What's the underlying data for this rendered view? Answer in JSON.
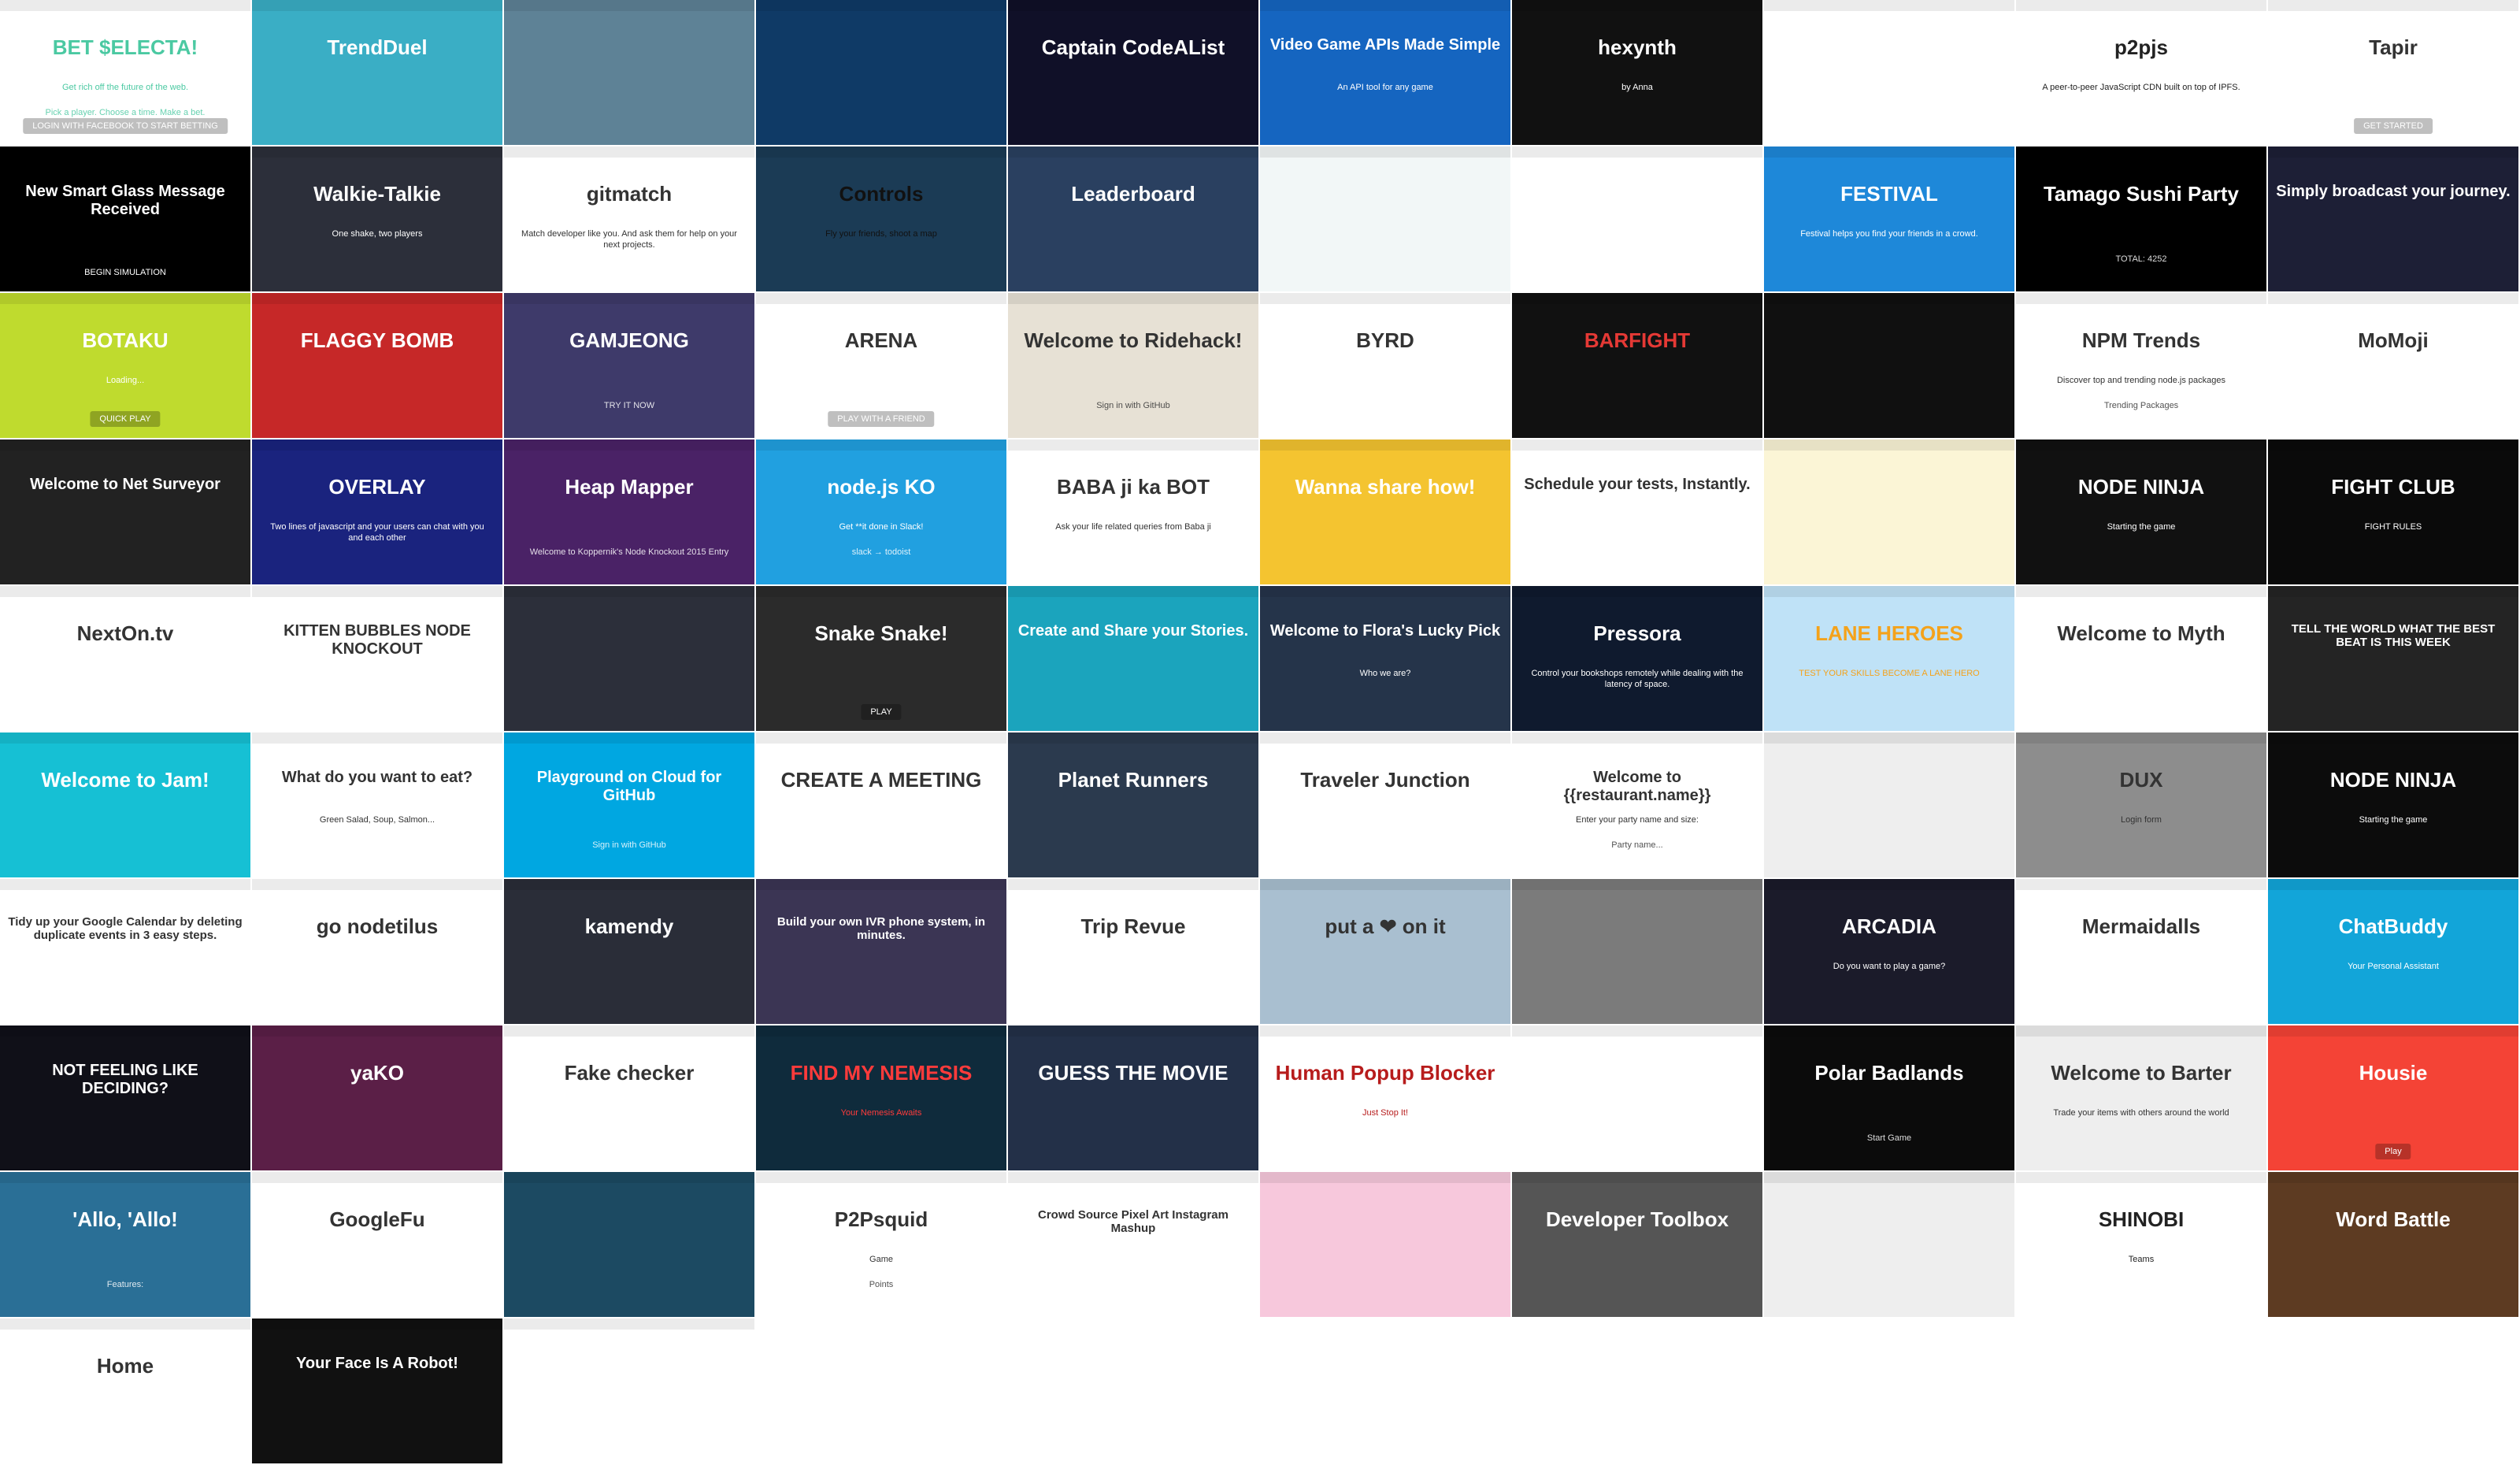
{
  "tiles": [
    {
      "title": "BET $ELECTA!",
      "subtitle": "Get rich off the future of the web.",
      "body": "Pick a player. Choose a time. Make a bet.",
      "button": "LOGIN WITH FACEBOOK TO START BETTING",
      "bg": "#ffffff",
      "fg": "#4bc9a2"
    },
    {
      "title": "TrendDuel",
      "subtitle": "",
      "body": "",
      "button": "",
      "bg": "#3aaec5",
      "fg": "#ffffff"
    },
    {
      "title": "",
      "subtitle": "",
      "body": "",
      "button": "",
      "bg": "#5e8296",
      "fg": "#ffffff"
    },
    {
      "title": "",
      "subtitle": "",
      "body": "",
      "button": "",
      "bg": "#0f3a66",
      "fg": "#ffffff"
    },
    {
      "title": "Captain CodeAList",
      "subtitle": "",
      "body": "",
      "button": "",
      "bg": "#101028",
      "fg": "#ffffff"
    },
    {
      "title": "Video Game APIs Made Simple",
      "subtitle": "An API tool for any game",
      "body": "",
      "button": "",
      "bg": "#1565c0",
      "fg": "#ffffff"
    },
    {
      "title": "hexynth",
      "subtitle": "by Anna",
      "body": "",
      "button": "",
      "bg": "#111111",
      "fg": "#ffffff"
    },
    {
      "title": "",
      "subtitle": "",
      "body": "",
      "button": "",
      "bg": "#ffffff",
      "fg": "#333333"
    },
    {
      "title": "p2pjs",
      "subtitle": "A peer-to-peer JavaScript CDN built on top of IPFS.",
      "body": "",
      "button": "",
      "bg": "#ffffff",
      "fg": "#222222"
    },
    {
      "title": "Tapir",
      "subtitle": "",
      "body": "",
      "button": "GET STARTED",
      "bg": "#ffffff",
      "fg": "#333333"
    },
    {
      "title": "New Smart Glass Message Received",
      "subtitle": "",
      "body": "",
      "button": "BEGIN SIMULATION",
      "bg": "#000000",
      "fg": "#ffffff"
    },
    {
      "title": "Walkie-Talkie",
      "subtitle": "One shake, two players",
      "body": "",
      "button": "",
      "bg": "#2c2f3a",
      "fg": "#ffffff"
    },
    {
      "title": "gitmatch",
      "subtitle": "Match developer like you. And ask them for help on your next projects.",
      "body": "",
      "button": "",
      "bg": "#ffffff",
      "fg": "#333333"
    },
    {
      "title": "Controls",
      "subtitle": "Fly your friends, shoot a map",
      "body": "",
      "button": "",
      "bg": "#1b3b55",
      "fg": "#111111"
    },
    {
      "title": "Leaderboard",
      "subtitle": "",
      "body": "",
      "button": "",
      "bg": "#2a4060",
      "fg": "#ffffff"
    },
    {
      "title": "",
      "subtitle": "",
      "body": "",
      "button": "",
      "bg": "#f2f7f7",
      "fg": "#333333"
    },
    {
      "title": "",
      "subtitle": "",
      "body": "",
      "button": "",
      "bg": "#ffffff",
      "fg": "#333333"
    },
    {
      "title": "FESTIVAL",
      "subtitle": "Festival helps you find your friends in a crowd.",
      "body": "",
      "button": "",
      "bg": "#1e88d9",
      "fg": "#ffffff"
    },
    {
      "title": "Tamago Sushi Party",
      "subtitle": "",
      "body": "TOTAL: 4252",
      "button": "",
      "bg": "#000000",
      "fg": "#ffffff"
    },
    {
      "title": "Simply broadcast your journey.",
      "subtitle": "",
      "body": "",
      "button": "",
      "bg": "#1d1f36",
      "fg": "#ffffff"
    },
    {
      "title": "BOTAKU",
      "subtitle": "Loading...",
      "body": "",
      "button": "QUICK PLAY",
      "bg": "#bfdb2e",
      "fg": "#ffffff"
    },
    {
      "title": "FLAGGY BOMB",
      "subtitle": "",
      "body": "",
      "button": "",
      "bg": "#c62828",
      "fg": "#ffffff"
    },
    {
      "title": "GAMJEONG",
      "subtitle": "",
      "body": "TRY IT NOW",
      "button": "",
      "bg": "#3e3a6a",
      "fg": "#ffffff"
    },
    {
      "title": "ARENA",
      "subtitle": "",
      "body": "",
      "button": "PLAY WITH A FRIEND",
      "bg": "#ffffff",
      "fg": "#333333"
    },
    {
      "title": "Welcome to Ridehack!",
      "subtitle": "",
      "body": "Sign in with GitHub",
      "button": "",
      "bg": "#e7e1d5",
      "fg": "#333333"
    },
    {
      "title": "BYRD",
      "subtitle": "",
      "body": "",
      "button": "",
      "bg": "#ffffff",
      "fg": "#333333"
    },
    {
      "title": "BARFIGHT",
      "subtitle": "",
      "body": "",
      "button": "",
      "bg": "#111111",
      "fg": "#e53935"
    },
    {
      "title": "",
      "subtitle": "",
      "body": "",
      "button": "",
      "bg": "#101010",
      "fg": "#ffffff"
    },
    {
      "title": "NPM Trends",
      "subtitle": "Discover top and trending node.js packages",
      "body": "Trending Packages",
      "button": "",
      "bg": "#ffffff",
      "fg": "#333333"
    },
    {
      "title": "MoMoji",
      "subtitle": "",
      "body": "",
      "button": "",
      "bg": "#ffffff",
      "fg": "#333333"
    },
    {
      "title": "Welcome to Net Surveyor",
      "subtitle": "",
      "body": "",
      "button": "",
      "bg": "#222222",
      "fg": "#ffffff"
    },
    {
      "title": "OVERLAY",
      "subtitle": "Two lines of javascript and your users can chat with you and each other",
      "body": "",
      "button": "",
      "bg": "#1a237e",
      "fg": "#ffffff"
    },
    {
      "title": "Heap Mapper",
      "subtitle": "",
      "body": "Welcome to Koppernik's Node Knockout 2015 Entry",
      "button": "",
      "bg": "#4a2266",
      "fg": "#ffffff"
    },
    {
      "title": "node.js KO",
      "subtitle": "Get **it done in Slack!",
      "body": "slack → todoist",
      "button": "",
      "bg": "#21a0e0",
      "fg": "#ffffff"
    },
    {
      "title": "BABA ji ka BOT",
      "subtitle": "Ask your life related queries from Baba ji",
      "body": "",
      "button": "",
      "bg": "#ffffff",
      "fg": "#333333"
    },
    {
      "title": "Wanna share how!",
      "subtitle": "",
      "body": "",
      "button": "",
      "bg": "#f4c430",
      "fg": "#ffffff"
    },
    {
      "title": "Schedule your tests, Instantly.",
      "subtitle": "",
      "body": "",
      "button": "",
      "bg": "#ffffff",
      "fg": "#333333"
    },
    {
      "title": "",
      "subtitle": "",
      "body": "",
      "button": "",
      "bg": "#fbf5d6",
      "fg": "#333333"
    },
    {
      "title": "NODE NINJA",
      "subtitle": "Starting the game",
      "body": "",
      "button": "",
      "bg": "#111111",
      "fg": "#ffffff"
    },
    {
      "title": "FIGHT CLUB",
      "subtitle": "FIGHT RULES",
      "body": "",
      "button": "",
      "bg": "#0a0a0a",
      "fg": "#ffffff"
    },
    {
      "title": "NextOn.tv",
      "subtitle": "",
      "body": "",
      "button": "",
      "bg": "#ffffff",
      "fg": "#333333"
    },
    {
      "title": "KITTEN BUBBLES NODE KNOCKOUT",
      "subtitle": "",
      "body": "",
      "button": "",
      "bg": "#ffffff",
      "fg": "#333333"
    },
    {
      "title": "",
      "subtitle": "",
      "body": "",
      "button": "",
      "bg": "#2c2f3a",
      "fg": "#ffffff"
    },
    {
      "title": "Snake Snake!",
      "subtitle": "",
      "body": "",
      "button": "PLAY",
      "bg": "#2b2b2b",
      "fg": "#ffffff"
    },
    {
      "title": "Create and Share your Stories.",
      "subtitle": "",
      "body": "",
      "button": "",
      "bg": "#1ba4bd",
      "fg": "#ffffff"
    },
    {
      "title": "Welcome to Flora's Lucky Pick",
      "subtitle": "Who we are?",
      "body": "",
      "button": "",
      "bg": "#25344a",
      "fg": "#ffffff"
    },
    {
      "title": "Pressora",
      "subtitle": "Control your bookshops remotely while dealing with the latency of space.",
      "body": "",
      "button": "",
      "bg": "#0f1a2e",
      "fg": "#ffffff"
    },
    {
      "title": "LANE HEROES",
      "subtitle": "TEST YOUR SKILLS BECOME A LANE HERO",
      "body": "",
      "button": "",
      "bg": "#bfe2f7",
      "fg": "#f4a21b"
    },
    {
      "title": "Welcome to Myth",
      "subtitle": "",
      "body": "",
      "button": "",
      "bg": "#ffffff",
      "fg": "#333333"
    },
    {
      "title": "TELL THE WORLD WHAT THE BEST BEAT IS THIS WEEK",
      "subtitle": "",
      "body": "",
      "button": "",
      "bg": "#242424",
      "fg": "#ffffff"
    },
    {
      "title": "Welcome to Jam!",
      "subtitle": "",
      "body": "",
      "button": "",
      "bg": "#16c0d4",
      "fg": "#ffffff"
    },
    {
      "title": "What do you want to eat?",
      "subtitle": "Green Salad, Soup, Salmon...",
      "body": "",
      "button": "",
      "bg": "#ffffff",
      "fg": "#333333"
    },
    {
      "title": "Playground on Cloud for GitHub",
      "subtitle": "",
      "body": "Sign in with GitHub",
      "button": "",
      "bg": "#00a7e1",
      "fg": "#ffffff"
    },
    {
      "title": "CREATE A MEETING",
      "subtitle": "",
      "body": "",
      "button": "",
      "bg": "#ffffff",
      "fg": "#333333"
    },
    {
      "title": "Planet Runners",
      "subtitle": "",
      "body": "",
      "button": "",
      "bg": "#2b3a4e",
      "fg": "#ffffff"
    },
    {
      "title": "Traveler Junction",
      "subtitle": "",
      "body": "",
      "button": "",
      "bg": "#ffffff",
      "fg": "#333333"
    },
    {
      "title": "Welcome to {{restaurant.name}}",
      "subtitle": "Enter your party name and size:",
      "body": "Party name...",
      "button": "",
      "bg": "#ffffff",
      "fg": "#333333"
    },
    {
      "title": "",
      "subtitle": "",
      "body": "",
      "button": "",
      "bg": "#eeeeee",
      "fg": "#333333"
    },
    {
      "title": "DUX",
      "subtitle": "Login form",
      "body": "",
      "button": "",
      "bg": "#8d8d8d",
      "fg": "#333333"
    },
    {
      "title": "NODE NINJA",
      "subtitle": "Starting the game",
      "body": "",
      "button": "",
      "bg": "#0c0c0c",
      "fg": "#ffffff"
    },
    {
      "title": "Tidy up your Google Calendar by deleting duplicate events in 3 easy steps.",
      "subtitle": "",
      "body": "",
      "button": "",
      "bg": "#ffffff",
      "fg": "#333333"
    },
    {
      "title": "go nodetilus",
      "subtitle": "",
      "body": "",
      "button": "",
      "bg": "#ffffff",
      "fg": "#333333"
    },
    {
      "title": "kamendy",
      "subtitle": "",
      "body": "",
      "button": "",
      "bg": "#2a2d38",
      "fg": "#ffffff"
    },
    {
      "title": "Build your own IVR phone system, in minutes.",
      "subtitle": "",
      "body": "",
      "button": "",
      "bg": "#3b3554",
      "fg": "#ffffff"
    },
    {
      "title": "Trip Revue",
      "subtitle": "",
      "body": "",
      "button": "",
      "bg": "#ffffff",
      "fg": "#333333"
    },
    {
      "title": "put a ❤ on it",
      "subtitle": "",
      "body": "",
      "button": "",
      "bg": "#a9bfd0",
      "fg": "#333333"
    },
    {
      "title": "",
      "subtitle": "",
      "body": "",
      "button": "",
      "bg": "#7b7b7b",
      "fg": "#ffffff"
    },
    {
      "title": "ARCADIA",
      "subtitle": "Do you want to play a game?",
      "body": "",
      "button": "",
      "bg": "#1b1b2a",
      "fg": "#ffffff"
    },
    {
      "title": "Mermaidalls",
      "subtitle": "",
      "body": "",
      "button": "",
      "bg": "#ffffff",
      "fg": "#333333"
    },
    {
      "title": "ChatBuddy",
      "subtitle": "Your Personal Assistant",
      "body": "",
      "button": "",
      "bg": "#12a5d9",
      "fg": "#ffffff"
    },
    {
      "title": "NOT FEELING LIKE DECIDING?",
      "subtitle": "",
      "body": "",
      "button": "",
      "bg": "#101018",
      "fg": "#ffffff"
    },
    {
      "title": "yaKO",
      "subtitle": "",
      "body": "",
      "button": "",
      "bg": "#5b1f47",
      "fg": "#ffffff"
    },
    {
      "title": "Fake checker",
      "subtitle": "",
      "body": "",
      "button": "",
      "bg": "#ffffff",
      "fg": "#333333"
    },
    {
      "title": "FIND MY NEMESIS",
      "subtitle": "Your Nemesis Awaits",
      "body": "",
      "button": "",
      "bg": "#0f2b3c",
      "fg": "#ff3b3b"
    },
    {
      "title": "GUESS THE MOVIE",
      "subtitle": "",
      "body": "",
      "button": "",
      "bg": "#233048",
      "fg": "#ffffff"
    },
    {
      "title": "Human Popup Blocker",
      "subtitle": "Just Stop It!",
      "body": "",
      "button": "",
      "bg": "#ffffff",
      "fg": "#b71c1c"
    },
    {
      "title": "",
      "subtitle": "",
      "body": "",
      "button": "",
      "bg": "#ffffff",
      "fg": "#333333"
    },
    {
      "title": "Polar Badlands",
      "subtitle": "",
      "body": "Start Game",
      "button": "",
      "bg": "#0b0b0b",
      "fg": "#ffffff"
    },
    {
      "title": "Welcome to Barter",
      "subtitle": "Trade your items with others around the world",
      "body": "",
      "button": "",
      "bg": "#eeeeee",
      "fg": "#333333"
    },
    {
      "title": "Housie",
      "subtitle": "",
      "body": "",
      "button": "Play",
      "bg": "#f44336",
      "fg": "#ffffff"
    },
    {
      "title": "'Allo, 'Allo!",
      "subtitle": "",
      "body": "Features:",
      "button": "",
      "bg": "#2a6f96",
      "fg": "#ffffff"
    },
    {
      "title": "GoogleFu",
      "subtitle": "",
      "body": "",
      "button": "",
      "bg": "#ffffff",
      "fg": "#333333"
    },
    {
      "title": "",
      "subtitle": "",
      "body": "",
      "button": "",
      "bg": "#1c4a62",
      "fg": "#ffffff"
    },
    {
      "title": "P2Psquid",
      "subtitle": "Game",
      "body": "Points",
      "button": "",
      "bg": "#ffffff",
      "fg": "#333333"
    },
    {
      "title": "Crowd Source Pixel Art Instagram Mashup",
      "subtitle": "",
      "body": "",
      "button": "",
      "bg": "#ffffff",
      "fg": "#333333"
    },
    {
      "title": "",
      "subtitle": "",
      "body": "",
      "button": "",
      "bg": "#f7c8dc",
      "fg": "#e91e63"
    },
    {
      "title": "Developer Toolbox",
      "subtitle": "",
      "body": "",
      "button": "",
      "bg": "#555555",
      "fg": "#ffffff"
    },
    {
      "title": "",
      "subtitle": "",
      "body": "",
      "button": "",
      "bg": "#eeeeee",
      "fg": "#333333"
    },
    {
      "title": "SHINOBI",
      "subtitle": "Teams",
      "body": "",
      "button": "",
      "bg": "#ffffff",
      "fg": "#222222"
    },
    {
      "title": "Word Battle",
      "subtitle": "",
      "body": "",
      "button": "",
      "bg": "#5d3b22",
      "fg": "#ffffff"
    },
    {
      "title": "Home",
      "subtitle": "",
      "body": "",
      "button": "",
      "bg": "#ffffff",
      "fg": "#333333"
    },
    {
      "title": "Your Face Is A Robot!",
      "subtitle": "",
      "body": "",
      "button": "",
      "bg": "#111111",
      "fg": "#ffffff"
    },
    {
      "title": "",
      "subtitle": "",
      "body": "",
      "button": "",
      "bg": "#ffffff",
      "fg": "#333333"
    }
  ]
}
